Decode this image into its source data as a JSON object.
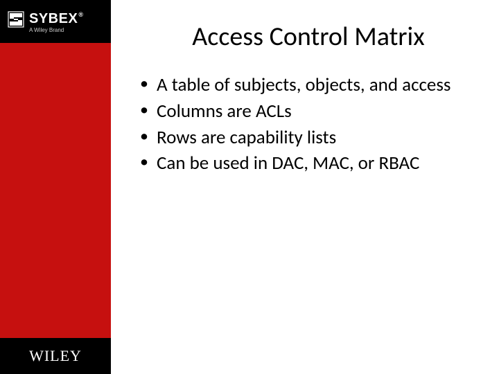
{
  "logo": {
    "sybex": "SYBEX",
    "sybex_reg": "®",
    "sybex_sub": "A Wiley Brand",
    "wiley": "WILEY"
  },
  "slide": {
    "title": "Access Control Matrix",
    "bullets": [
      "A table of subjects, objects, and access",
      "Columns are ACLs",
      "Rows are capability lists",
      "Can be used in DAC, MAC, or RBAC"
    ]
  }
}
